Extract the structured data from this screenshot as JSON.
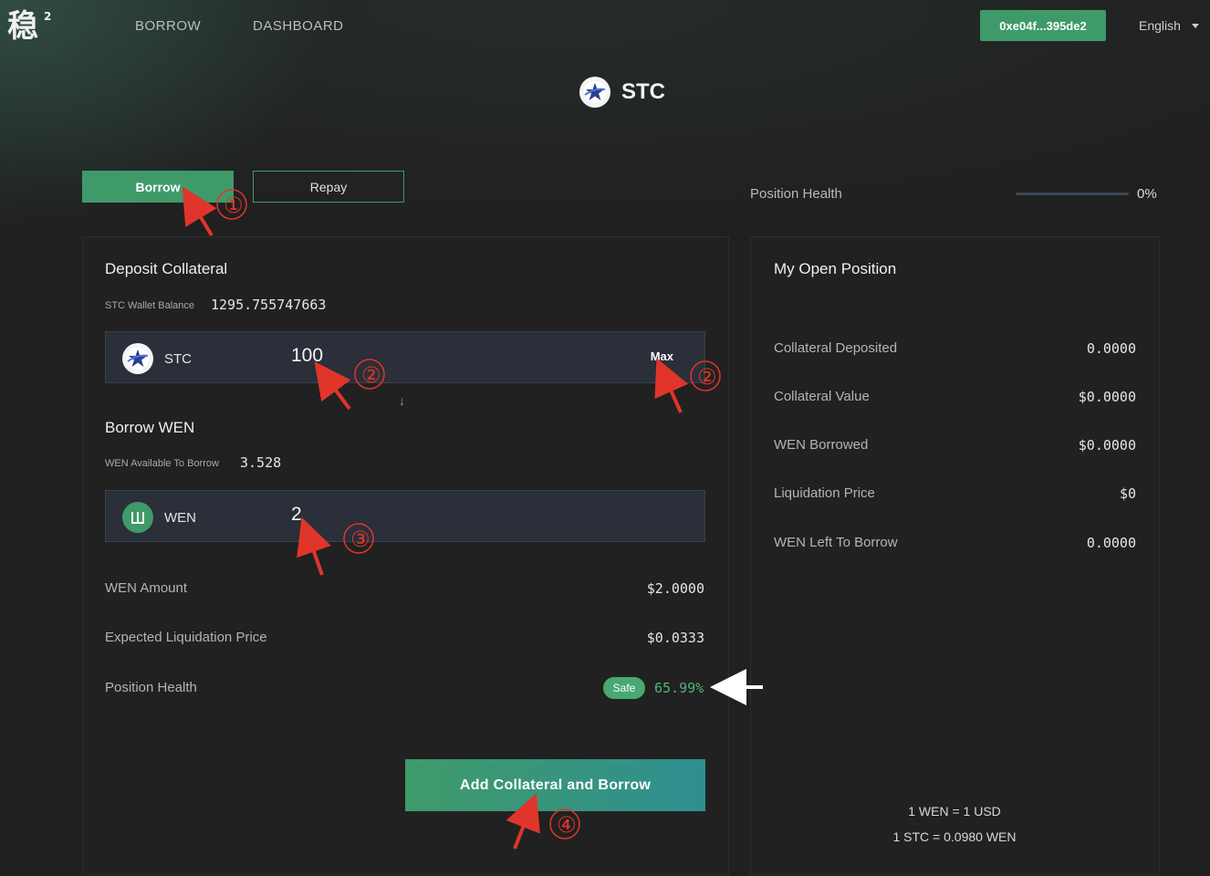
{
  "header": {
    "logo_text": "稳",
    "logo_sup": "2",
    "nav": [
      "BORROW",
      "DASHBOARD"
    ],
    "wallet_address": "0xe04f...395de2",
    "language": "English"
  },
  "token": {
    "name": "STC"
  },
  "tabs": {
    "borrow": "Borrow",
    "repay": "Repay"
  },
  "position_health_top": {
    "label": "Position Health",
    "value": "0%",
    "level": 0
  },
  "deposit": {
    "title": "Deposit Collateral",
    "balance_label": "STC Wallet Balance",
    "balance_value": "1295.755747663",
    "token": "STC",
    "amount": "100",
    "max_label": "Max"
  },
  "borrow": {
    "title": "Borrow WEN",
    "available_label": "WEN Available To Borrow",
    "available_value": "3.528",
    "token": "WEN",
    "amount": "2"
  },
  "summary": {
    "wen_amount_label": "WEN Amount",
    "wen_amount_value": "$2.0000",
    "liq_price_label": "Expected Liquidation Price",
    "liq_price_value": "$0.0333",
    "health_label": "Position Health",
    "health_badge": "Safe",
    "health_value": "65.99%"
  },
  "action_button": "Add Collateral and Borrow",
  "open_position": {
    "title": "My Open Position",
    "rows": [
      {
        "label": "Collateral Deposited",
        "value": "0.0000"
      },
      {
        "label": "Collateral Value",
        "value": "$0.0000"
      },
      {
        "label": "WEN Borrowed",
        "value": "$0.0000"
      },
      {
        "label": "Liquidation Price",
        "value": "$0"
      },
      {
        "label": "WEN Left To Borrow",
        "value": "0.0000"
      }
    ],
    "rate1": "1 WEN = 1 USD",
    "rate2": "1 STC = 0.0980 WEN"
  },
  "annotations": [
    "①",
    "②",
    "②",
    "③",
    "④"
  ],
  "colors": {
    "accent": "#3f9a6a",
    "annotation": "#e0352b",
    "safe": "#4fb47a"
  },
  "icons": [
    "stc-star-icon",
    "wen-icon",
    "chevron-down-icon",
    "arrow-down-icon"
  ]
}
